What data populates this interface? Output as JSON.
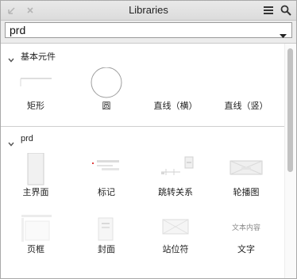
{
  "window": {
    "title": "Libraries"
  },
  "library_select": {
    "value": "prd"
  },
  "sections": [
    {
      "title": "基本元件",
      "items": [
        {
          "label": "矩形",
          "icon": "rectangle-widget-icon"
        },
        {
          "label": "圆",
          "icon": "circle-widget-icon"
        },
        {
          "label": "直线（横）",
          "icon": "horizontal-line-icon"
        },
        {
          "label": "直线（竖）",
          "icon": "vertical-line-icon"
        }
      ]
    },
    {
      "title": "prd",
      "items": [
        {
          "label": "主界面",
          "icon": "main-screen-thumb-icon"
        },
        {
          "label": "标记",
          "icon": "marker-thumb-icon"
        },
        {
          "label": "跳转关系",
          "icon": "jump-relation-thumb-icon"
        },
        {
          "label": "轮播图",
          "icon": "carousel-thumb-icon"
        },
        {
          "label": "页框",
          "icon": "page-frame-thumb-icon"
        },
        {
          "label": "封面",
          "icon": "cover-thumb-icon"
        },
        {
          "label": "站位符",
          "icon": "placeholder-thumb-icon"
        },
        {
          "label": "文字",
          "icon": "text-thumb-icon",
          "preview_text": "文本内容"
        }
      ]
    }
  ]
}
